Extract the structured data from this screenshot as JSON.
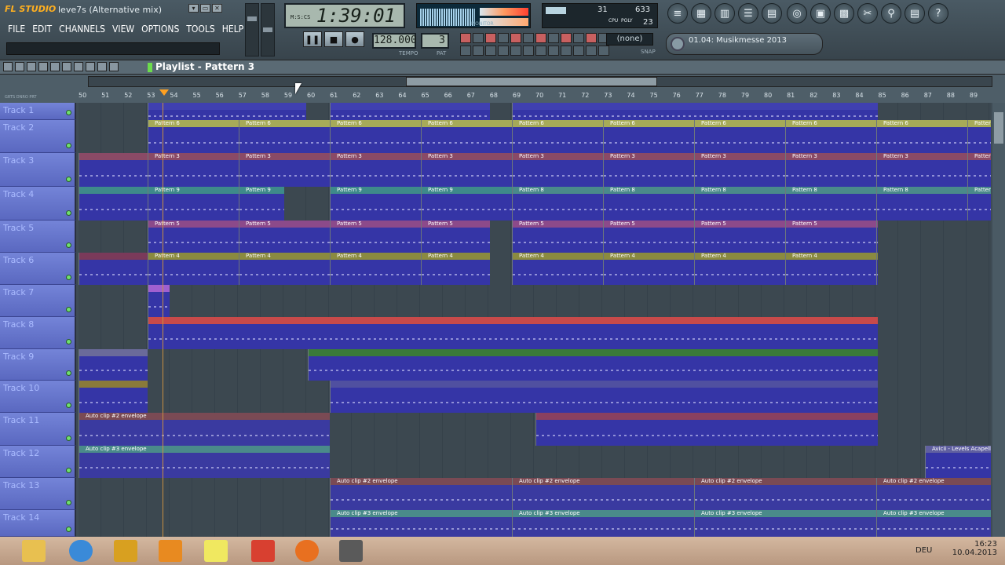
{
  "app": {
    "logo": "FL STUDIO",
    "song_title": "leve7s (Alternative mix)"
  },
  "menu": [
    "FILE",
    "EDIT",
    "CHANNELS",
    "VIEW",
    "OPTIONS",
    "TOOLS",
    "HELP"
  ],
  "time_display": "1:39:01",
  "time_label": "M:S:CS",
  "monitor_label": "MONITOR",
  "cpu": {
    "ram": "31",
    "top": "633",
    "cpu_label": "CPU",
    "poly_label": "POLY",
    "poly": "23"
  },
  "tempo": {
    "value": "128.000",
    "label": "TEMPO"
  },
  "pattern": {
    "value": "3",
    "label": "PAT"
  },
  "snap": {
    "value": "(none)",
    "label": "SNAP"
  },
  "browser_item": "01.04: Musikmesse 2013",
  "playlist_title": "Playlist - Pattern 3",
  "ruler_modes": "GRTS DNRO PRT",
  "bars": [
    "50",
    "51",
    "52",
    "53",
    "54",
    "55",
    "56",
    "57",
    "58",
    "59",
    "60",
    "61",
    "62",
    "63",
    "64",
    "65",
    "66",
    "67",
    "68",
    "69",
    "70",
    "71",
    "72",
    "73",
    "74",
    "75",
    "76",
    "77",
    "78",
    "79",
    "80",
    "81",
    "82",
    "83",
    "84",
    "85",
    "86",
    "87",
    "88",
    "89"
  ],
  "tracks": [
    "Track 1",
    "Track 2",
    "Track 3",
    "Track 4",
    "Track 5",
    "Track 6",
    "Track 7",
    "Track 8",
    "Track 9",
    "Track 10",
    "Track 11",
    "Track 12",
    "Track 13",
    "Track 14"
  ],
  "clip_labels": {
    "p6": "Pattern 6",
    "p3": "Pattern 3",
    "p9": "Pattern 9",
    "p8": "Pattern 8",
    "p5": "Pattern 5",
    "p4": "Pattern 4",
    "a2": "Auto clip #2 envelope",
    "a3": "Auto clip #3 envelope",
    "avicii": "Avicii - Levels Acapell"
  },
  "taskbar": {
    "lang": "DEU",
    "time": "16:23",
    "date": "10.04.2013"
  },
  "colors": {
    "pattern_body": "#3535a6",
    "p6": "#a6aa58",
    "p3": "#8a4a66",
    "p9": "#3e8a8a",
    "p5": "#8c4a8a",
    "p4": "#8a8a40",
    "red": "#c84a4a",
    "green": "#3a7a3a",
    "purple": "#5050a0",
    "auto": "#7a4a54",
    "auto2": "#4a8a8a"
  }
}
